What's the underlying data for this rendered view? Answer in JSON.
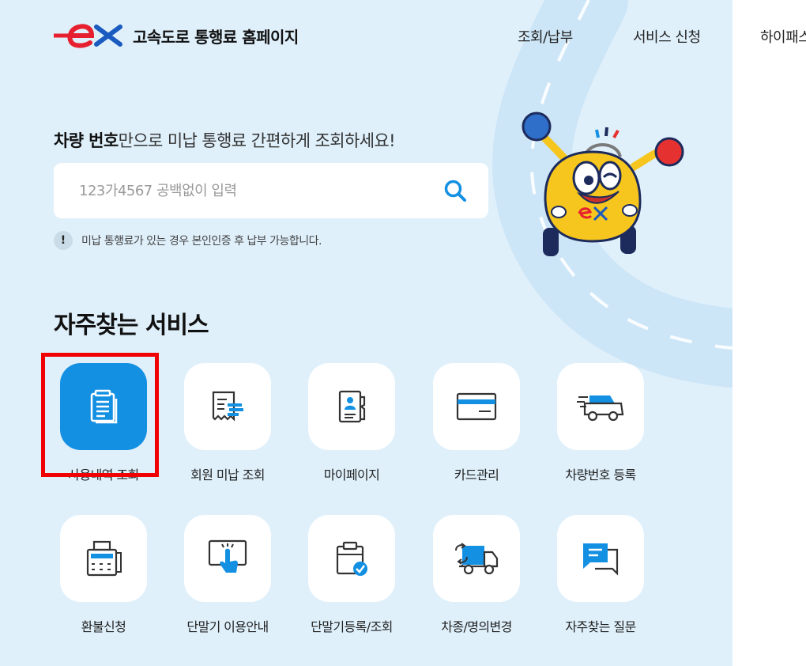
{
  "header": {
    "logo_text": "ex",
    "site_title": "고속도로 통행료 홈페이지",
    "nav": [
      "조회/납부",
      "서비스 신청",
      "하이패스"
    ]
  },
  "search": {
    "heading_bold": "차량 번호",
    "heading_rest": "만으로 미납 통행료 간편하게 조회하세요!",
    "placeholder": "123가4567 공백없이 입력",
    "notice_icon": "!",
    "notice": "미납 통행료가 있는 경우 본인인증 후 납부 가능합니다."
  },
  "services": {
    "title": "자주찾는 서비스",
    "items": [
      {
        "label": "사용내역 조회",
        "icon": "document-list-icon"
      },
      {
        "label": "회원 미납 조회",
        "icon": "receipt-icon"
      },
      {
        "label": "마이페이지",
        "icon": "id-card-icon"
      },
      {
        "label": "카드관리",
        "icon": "credit-card-icon"
      },
      {
        "label": "차량번호 등록",
        "icon": "car-icon"
      },
      {
        "label": "환불신청",
        "icon": "fax-machine-icon"
      },
      {
        "label": "단말기 이용안내",
        "icon": "touch-terminal-icon"
      },
      {
        "label": "단말기등록/조회",
        "icon": "clipboard-check-icon"
      },
      {
        "label": "차종/명의변경",
        "icon": "truck-exchange-icon"
      },
      {
        "label": "자주찾는 질문",
        "icon": "chat-bubbles-icon"
      }
    ]
  },
  "colors": {
    "background": "#dff0fb",
    "accent": "#1490e2",
    "logo_red": "#e6202e",
    "logo_blue": "#1a5bbf",
    "highlight": "#f00000"
  }
}
